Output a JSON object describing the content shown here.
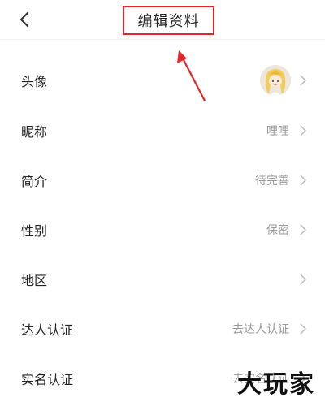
{
  "header": {
    "title": "编辑资料",
    "back_icon": "chevron-left-icon",
    "highlight_color": "#e0262b"
  },
  "rows": [
    {
      "label": "头像",
      "value": "",
      "type": "avatar"
    },
    {
      "label": "昵称",
      "value": "哩哩"
    },
    {
      "label": "简介",
      "value": "待完善"
    },
    {
      "label": "性别",
      "value": "保密"
    },
    {
      "label": "地区",
      "value": ""
    },
    {
      "label": "达人认证",
      "value": "去达人认证"
    },
    {
      "label": "实名认证",
      "value": "去实名认证"
    }
  ],
  "watermark": {
    "text": "大玩家"
  },
  "colors": {
    "label": "#222222",
    "value": "#9a9a9a",
    "chevron": "#b8b8b8",
    "annotation": "#e0262b"
  }
}
